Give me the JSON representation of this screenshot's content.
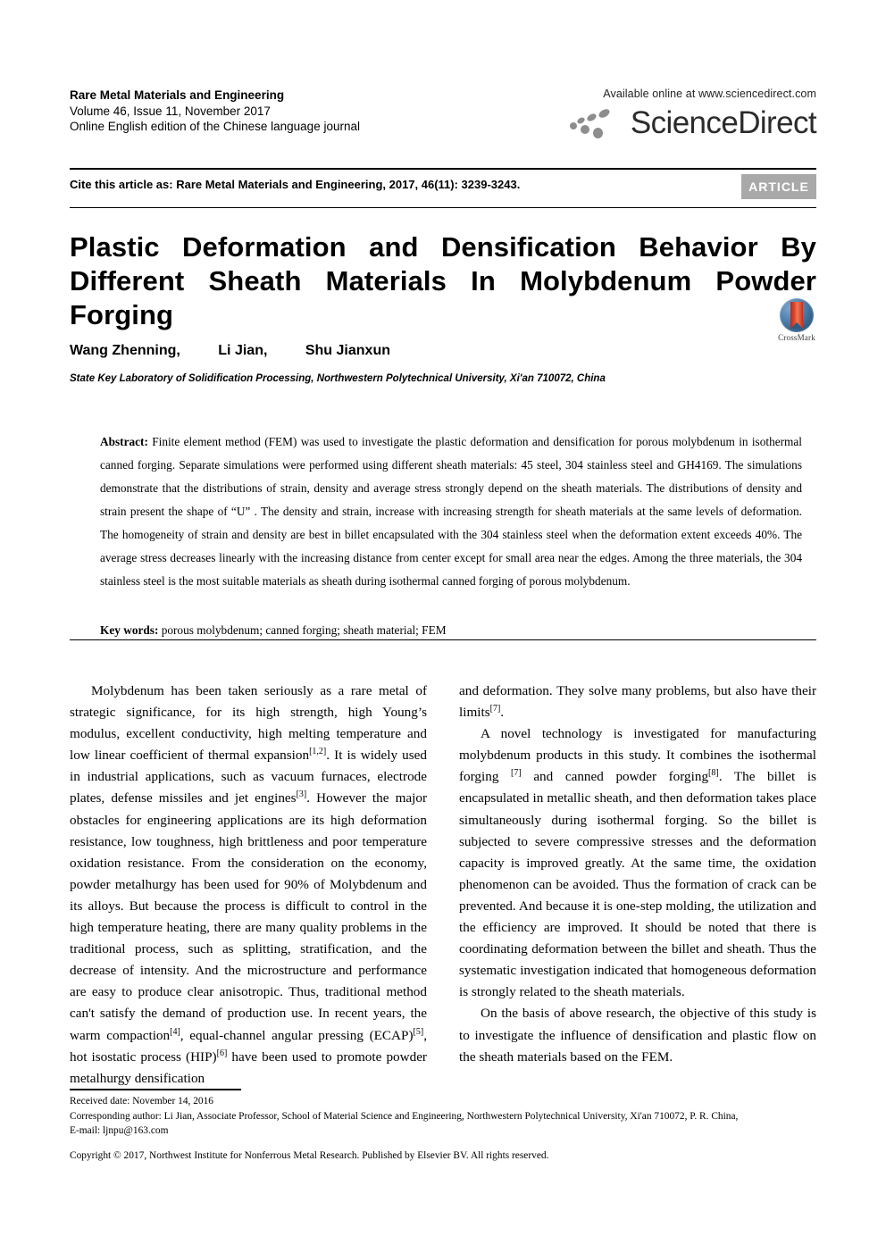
{
  "masthead": {
    "journal_title": "Rare Metal Materials and Engineering",
    "volume_line": "Volume 46, Issue 11, November 2017",
    "edition_line": "Online English edition of the Chinese language journal",
    "available_online": "Available online at www.sciencedirect.com",
    "sciencedirect_word": "ScienceDirect"
  },
  "cite": {
    "text": "Cite this article as: Rare Metal Materials and Engineering, 2017, 46(11): 3239-3243.",
    "badge": "ARTICLE",
    "badge_color": "#a9a9a9"
  },
  "title": {
    "line1": "Plastic Deformation and Densification Behavior By",
    "line2": "Different Sheath Materials In Molybdenum Powder",
    "line3": "Forging",
    "full": "Plastic Deformation and Densification Behavior By Different Sheath Materials In Molybdenum Powder Forging"
  },
  "crossmark": {
    "label": "CrossMark"
  },
  "authors": {
    "list": [
      "Wang Zhenning,",
      "Li Jian,",
      "Shu Jianxun"
    ],
    "affiliation": "State Key Laboratory of Solidification Processing, Northwestern Polytechnical University, Xi'an 710072, China"
  },
  "abstract": {
    "label": "Abstract:",
    "body": " Finite element method (FEM) was used to investigate the plastic deformation and densification for porous molybdenum in isothermal canned forging. Separate simulations were performed using different sheath materials: 45 steel, 304 stainless steel and GH4169. The simulations demonstrate that the distributions of strain, density and average stress strongly depend on the sheath materials. The distributions of density and strain present the shape of “U” . The density and strain, increase with increasing strength for sheath materials at the same levels of deformation. The homogeneity of strain and density are best in billet encapsulated with the 304 stainless steel when the deformation extent exceeds 40%. The average stress decreases linearly with the increasing distance from center except for small area near the edges. Among the three materials, the 304 stainless steel is the most suitable materials as sheath during isothermal canned forging of porous molybdenum.",
    "keywords_label": "Key words:",
    "keywords_body": " porous molybdenum; canned forging; sheath material; FEM"
  },
  "body": {
    "left": {
      "p1_a": "Molybdenum has been taken seriously as a rare metal of strategic significance, for its high strength, high Young’s modulus, excellent conductivity, high melting temperature and low linear coefficient of thermal expansion",
      "p1_sup1": "[1,2]",
      "p1_b": ". It is widely used in industrial applications, such as vacuum furnaces, electrode plates, defense missiles and jet engines",
      "p1_sup2": "[3]",
      "p1_c": ". However the major obstacles for engineering applications are its high deformation resistance, low toughness, high brittleness and poor temperature oxidation resistance. From the consideration on the economy, powder metalhurgy has been used for 90% of Molybdenum and its alloys. But because the process is difficult to control in the high temperature heating, there are many quality problems in the traditional process, such as splitting, stratification, and the decrease of intensity. And the microstructure and performance are easy to produce clear anisotropic. Thus, traditional method can't satisfy the demand of production use. In recent years, the warm compaction",
      "p1_sup3": "[4]",
      "p1_d": ", equal-channel angular pressing (ECAP)",
      "p1_sup4": "[5]",
      "p1_e": ", hot isostatic process (HIP)",
      "p1_sup5": "[6]",
      "p1_f": " have been used to promote powder metalhurgy densification"
    },
    "right": {
      "p1_a": "and deformation. They solve many problems, but also have their limits",
      "p1_sup1": "[7]",
      "p1_b": ".",
      "p2_a": "A novel technology is investigated for manufacturing molybdenum products in this study. It combines the isothermal forging ",
      "p2_sup1": "[7]",
      "p2_b": " and canned powder forging",
      "p2_sup2": "[8]",
      "p2_c": ". The billet is encapsulated in metallic sheath, and then deformation takes place simultaneously during isothermal forging. So the billet is subjected to severe compressive stresses and the deformation capacity is improved greatly. At the same time, the oxidation phenomenon can be avoided. Thus the formation of crack can be prevented. And because it is one-step molding, the utilization and the efficiency are improved. It should be noted that there is coordinating deformation between the billet and sheath. Thus the systematic investigation indicated that homogeneous deformation is strongly related to the sheath materials.",
      "p3": "On the basis of above research, the objective of this study is to investigate the influence of densification and plastic flow on the sheath materials based on the FEM."
    }
  },
  "footnotes": {
    "received": "Received date: November 14, 2016",
    "corresponding": "Corresponding author: Li Jian, Associate Professor, School of Material Science and Engineering, Northwestern Polytechnical University, Xi'an 710072, P. R. China,",
    "email": "E-mail: ljnpu@163.com",
    "copyright": "Copyright © 2017, Northwest Institute for Nonferrous Metal Research. Published by Elsevier BV. All rights reserved."
  }
}
